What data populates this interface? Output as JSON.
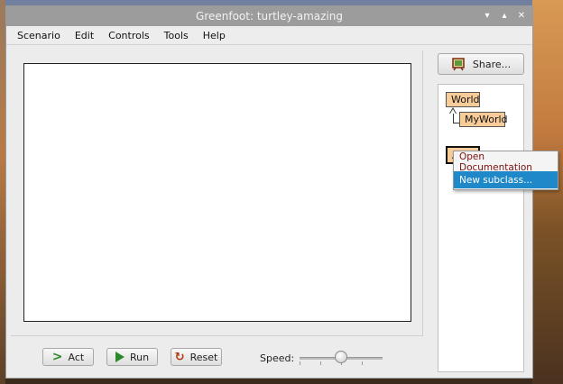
{
  "window": {
    "title": "Greenfoot: turtley-amazing",
    "controls": [
      "chevron-down-icon",
      "chevron-up-icon",
      "close-icon"
    ]
  },
  "menubar": {
    "items": [
      "Scenario",
      "Edit",
      "Controls",
      "Tools",
      "Help"
    ]
  },
  "controls": {
    "act_label": "Act",
    "run_label": "Run",
    "reset_label": "Reset",
    "speed_label": "Speed:",
    "speed_value": 0.5
  },
  "share": {
    "label": "Share..."
  },
  "classes": {
    "world": "World",
    "myworld": "MyWorld",
    "actor": "Actor"
  },
  "context_menu": {
    "items": [
      "Open Documentation",
      "New subclass..."
    ],
    "selected_index": 1
  },
  "colors": {
    "class_fill": "#f7cc98",
    "menu_highlight": "#1e88c8",
    "menu_text": "#7a1010",
    "run_green": "#2a8a2a"
  }
}
